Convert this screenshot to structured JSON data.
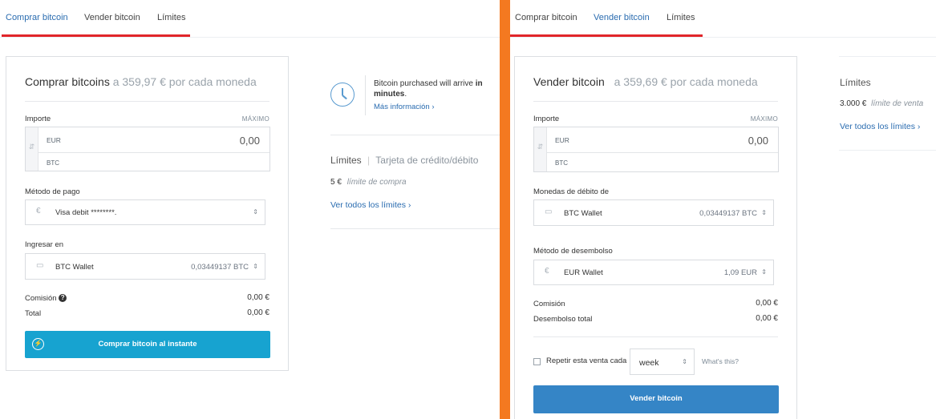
{
  "left": {
    "tabs": [
      {
        "label": "Comprar bitcoin",
        "active": true
      },
      {
        "label": "Vender bitcoin",
        "active": false
      },
      {
        "label": "Límites",
        "active": false
      }
    ],
    "card": {
      "title": "Comprar bitcoins",
      "price": "a 359,97 € por cada moneda",
      "importe_label": "Importe",
      "maximo": "MÁXIMO",
      "currency_top": "EUR",
      "amount_value": "0,00",
      "currency_bottom": "BTC",
      "payment_label": "Método de pago",
      "payment_value": "Visa debit ********.",
      "deposit_label": "Ingresar en",
      "deposit_value": "BTC Wallet",
      "deposit_balance": "0,03449137 BTC",
      "fee_label": "Comisión",
      "fee_value": "0,00 €",
      "total_label": "Total",
      "total_value": "0,00 €",
      "button": "Comprar bitcoin al instante"
    },
    "info": {
      "text_part1": "Bitcoin purchased",
      "text_part2": " will arrive ",
      "text_bold1": "in",
      "text_bold2": "minutes",
      "text_end": ".",
      "more_link": "Más información ›"
    },
    "limits": {
      "title": "Límites",
      "method": "Tarjeta de crédito/débito",
      "amount": "5 €",
      "amount_desc": "límite de compra",
      "link": "Ver todos los límites ›"
    }
  },
  "right": {
    "tabs": [
      {
        "label": "Comprar bitcoin",
        "active": false
      },
      {
        "label": "Vender bitcoin",
        "active": true
      },
      {
        "label": "Límites",
        "active": false
      }
    ],
    "card": {
      "title": "Vender bitcoin",
      "price": "a 359,69 € por cada moneda",
      "importe_label": "Importe",
      "maximo": "MÁXIMO",
      "currency_top": "EUR",
      "amount_value": "0,00",
      "currency_bottom": "BTC",
      "debit_label": "Monedas de débito de",
      "debit_value": "BTC Wallet",
      "debit_balance": "0,03449137 BTC",
      "payout_label": "Método de desembolso",
      "payout_value": "EUR Wallet",
      "payout_balance": "1,09 EUR",
      "fee_label": "Comisión",
      "fee_value": "0,00 €",
      "payout_total_label": "Desembolso total",
      "payout_total_value": "0,00 €",
      "repeat_label": "Repetir esta venta cada",
      "repeat_value": "week",
      "whats_this": "What's this?",
      "button": "Vender bitcoin"
    },
    "limits": {
      "title": "Límites",
      "amount": "3.000 €",
      "amount_desc": "límite de venta",
      "link": "Ver todos los límites ›"
    }
  },
  "colors": {
    "accent_red": "#e1252a",
    "buy_button": "#17a3d0",
    "sell_button": "#3585c6",
    "divider_orange": "#f47920",
    "link_blue": "#2a6cb0"
  }
}
